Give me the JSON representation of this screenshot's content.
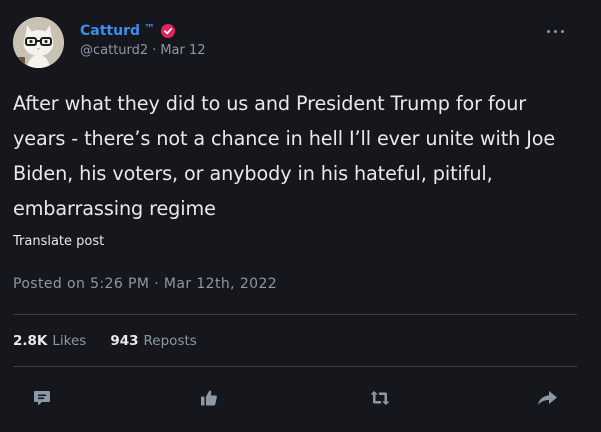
{
  "author": {
    "display_name": "Catturd",
    "tm": "™",
    "handle": "@catturd2",
    "separator": "·",
    "date": "Mar 12"
  },
  "post": {
    "text": "After what they did to us and President Trump for four years  - there’s not a chance in hell I’ll ever unite with Joe Biden, his voters, or anybody in his hateful, pitiful, embarrassing regime",
    "translate_label": "Translate post",
    "timestamp": "Posted on 5:26 PM · Mar 12th, 2022"
  },
  "stats": {
    "likes_count": "2.8K",
    "likes_label": "Likes",
    "reposts_count": "943",
    "reposts_label": "Reposts"
  },
  "actions": [
    {
      "name": "reply",
      "icon": "comment-icon"
    },
    {
      "name": "like",
      "icon": "thumbs-up-icon"
    },
    {
      "name": "repost",
      "icon": "repost-icon"
    },
    {
      "name": "share",
      "icon": "share-arrow-icon"
    }
  ],
  "colors": {
    "background": "#15171c",
    "name": "#3a8ff0",
    "badge": "#e0245e",
    "muted": "#8b98a5",
    "text": "#e7e9ea"
  }
}
